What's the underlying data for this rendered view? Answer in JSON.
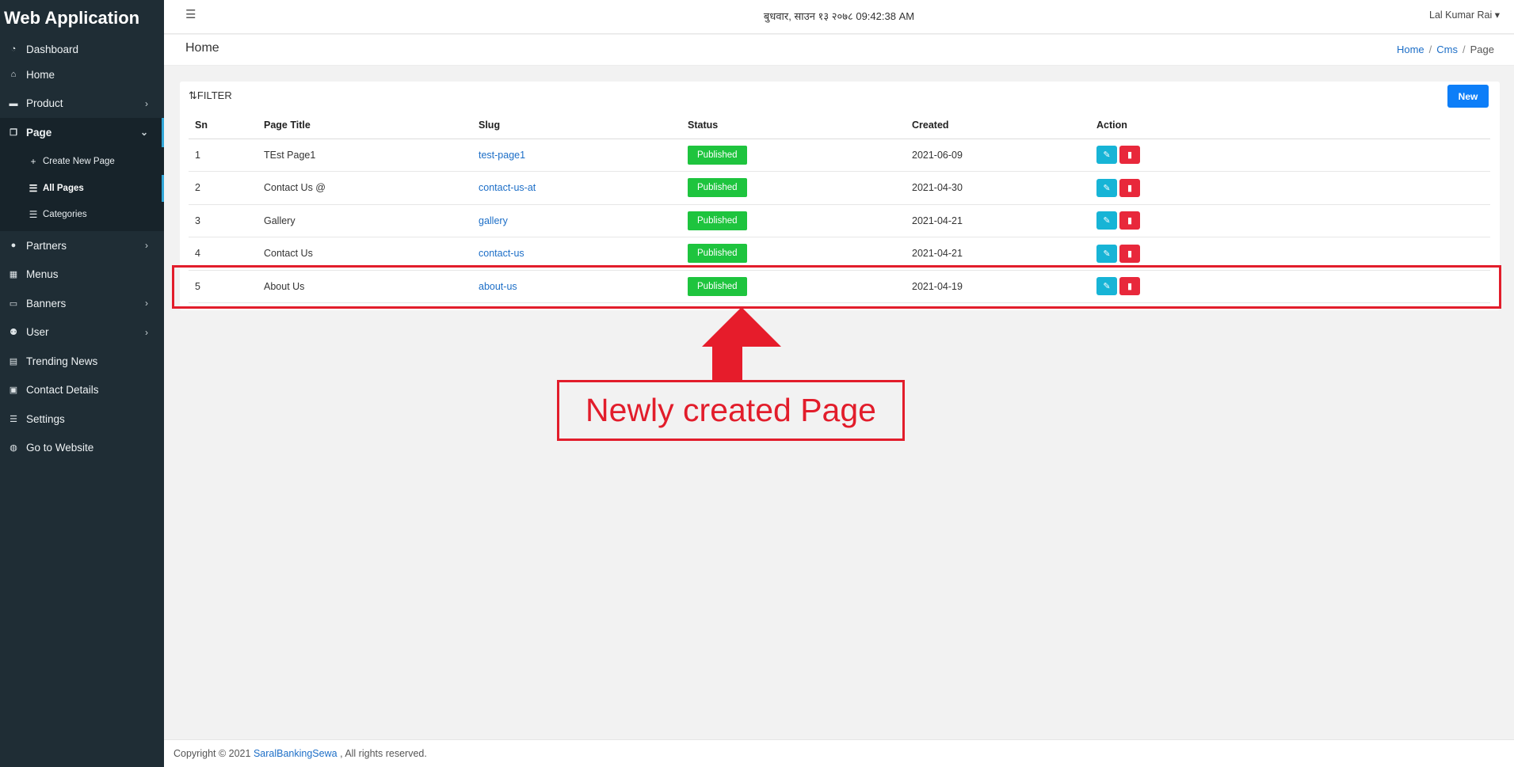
{
  "sidebar": {
    "brand": "Web Application",
    "items": [
      {
        "label": "Dashboard",
        "icon": "dashboard-icon"
      },
      {
        "label": "Home",
        "icon": "home-icon"
      },
      {
        "label": "Product",
        "icon": "product-icon"
      },
      {
        "label": "Page",
        "icon": "page-icon"
      },
      {
        "label": "Partners",
        "icon": "partners-icon"
      },
      {
        "label": "Menus",
        "icon": "grid-icon"
      },
      {
        "label": "Banners",
        "icon": "banners-icon"
      },
      {
        "label": "User",
        "icon": "users-icon"
      },
      {
        "label": "Trending News",
        "icon": "newspaper-icon"
      },
      {
        "label": "Contact Details",
        "icon": "contact-icon"
      },
      {
        "label": "Settings",
        "icon": "sliders-icon"
      },
      {
        "label": "Go to Website",
        "icon": "globe-icon"
      }
    ],
    "page_submenu": [
      {
        "label": "Create New Page",
        "icon": "plus-icon"
      },
      {
        "label": "All Pages",
        "icon": "list-icon"
      },
      {
        "label": "Categories",
        "icon": "list-icon"
      }
    ]
  },
  "topbar": {
    "datetime": "बुधवार, साउन १३ २०७८ 09:42:38 AM",
    "user": "Lal Kumar Rai"
  },
  "pagebar": {
    "title": "Home",
    "breadcrumb": [
      "Home",
      "Cms",
      "Page"
    ]
  },
  "card": {
    "filter_label": "FILTER",
    "new_button": "New",
    "columns": [
      "Sn",
      "Page Title",
      "Slug",
      "Status",
      "Created",
      "Action"
    ],
    "rows": [
      {
        "sn": "1",
        "title": "TEst Page1",
        "slug": "test-page1",
        "status": "Published",
        "created": "2021-06-09"
      },
      {
        "sn": "2",
        "title": "Contact Us @",
        "slug": "contact-us-at",
        "status": "Published",
        "created": "2021-04-30"
      },
      {
        "sn": "3",
        "title": "Gallery",
        "slug": "gallery",
        "status": "Published",
        "created": "2021-04-21"
      },
      {
        "sn": "4",
        "title": "Contact Us",
        "slug": "contact-us",
        "status": "Published",
        "created": "2021-04-21"
      },
      {
        "sn": "5",
        "title": "About Us",
        "slug": "about-us",
        "status": "Published",
        "created": "2021-04-19"
      }
    ]
  },
  "annotation": {
    "text": "Newly created Page"
  },
  "footer": {
    "prefix": "Copyright © 2021",
    "link": "SaralBankingSewa",
    "suffix": ", All rights reserved."
  },
  "colors": {
    "sidebar_bg": "#1f2d35",
    "accent": "#31a7d8",
    "primary": "#0d7ef8",
    "success": "#1ec43e",
    "info": "#17b4d6",
    "danger": "#e8283b",
    "annotation": "#e21d2b"
  }
}
